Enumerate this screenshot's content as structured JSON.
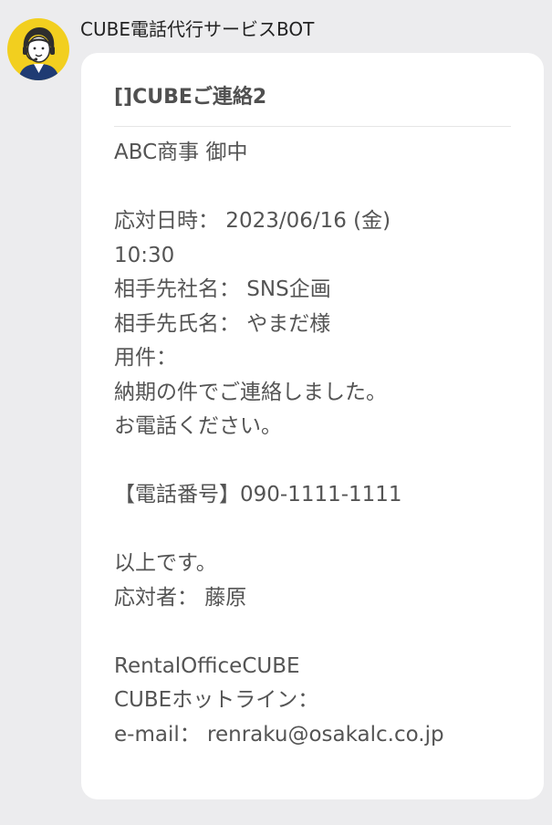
{
  "sender": {
    "name": "CUBE電話代行サービスBOT",
    "avatar_icon": "operator-avatar-icon",
    "avatar_bg": "#f2cf1f"
  },
  "message": {
    "title": "[]CUBEご連絡2",
    "lines": [
      "ABC商事 御中",
      "",
      "応対日時： 2023/06/16 (金)",
      "10:30",
      "相手先社名： SNS企画",
      "相手先氏名： やまだ様",
      "用件：",
      "納期の件でご連絡しました。",
      "お電話ください。",
      "",
      "【電話番号】090-1111-1111",
      "",
      "以上です。",
      "応対者： 藤原",
      "",
      "RentalOfficeCUBE",
      "CUBEホットライン：",
      "e-mail： renraku@osakalc.co.jp"
    ]
  }
}
